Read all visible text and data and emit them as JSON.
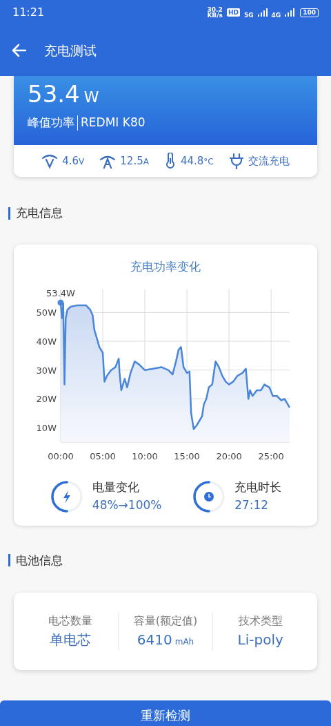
{
  "status_bar": {
    "time": "11:21",
    "speed": "30.2",
    "speed_unit": "KB/s",
    "hd": "HD",
    "net1": "5G",
    "net2": "4G",
    "battery": "100"
  },
  "header": {
    "title": "充电测试"
  },
  "power_card": {
    "value": "53.4",
    "unit": "W",
    "label": "峰值功率",
    "device": "REDMI K80",
    "stats": [
      {
        "kind": "voltage",
        "value": "4.6",
        "unit": "V"
      },
      {
        "kind": "current",
        "value": "12.5",
        "unit": "A"
      },
      {
        "kind": "temperature",
        "value": "44.8",
        "unit": "°C"
      },
      {
        "kind": "plug",
        "value": "交流充电"
      }
    ]
  },
  "charging_section": {
    "title": "充电信息",
    "chart_data": {
      "type": "area",
      "grid": true,
      "title": "充电功率变化",
      "xlim": [
        0,
        27.2
      ],
      "ylim": [
        5,
        58
      ],
      "xticks": [
        {
          "value": 0,
          "label": "00:00"
        },
        {
          "value": 5,
          "label": "05:00"
        },
        {
          "value": 10,
          "label": "10:00"
        },
        {
          "value": 15,
          "label": "15:00"
        },
        {
          "value": 20,
          "label": "20:00"
        },
        {
          "value": 25,
          "label": "25:00"
        }
      ],
      "yticks": [
        {
          "value": 10,
          "label": "10W"
        },
        {
          "value": 20,
          "label": "20W"
        },
        {
          "value": 30,
          "label": "30W"
        },
        {
          "value": 40,
          "label": "40W"
        },
        {
          "value": 50,
          "label": "50W"
        }
      ],
      "x": [
        0,
        0.15,
        0.3,
        0.45,
        0.6,
        0.8,
        1.2,
        2,
        3,
        3.5,
        3.8,
        4,
        4.3,
        4.6,
        5,
        5.2,
        5.5,
        6,
        6.5,
        6.9,
        7,
        7.2,
        7.6,
        7.9,
        8.3,
        8.8,
        9.3,
        10,
        11,
        12,
        12.8,
        13.3,
        13.7,
        14,
        14.3,
        14.6,
        15,
        15.3,
        15.5,
        15.8,
        16.2,
        16.8,
        17,
        17.3,
        17.6,
        18,
        18.4,
        18.8,
        19.2,
        19.6,
        20,
        20.5,
        21,
        21.6,
        22,
        22.3,
        22.5,
        22.8,
        23.3,
        23.8,
        24.2,
        24.8,
        25.2,
        25.7,
        26.2,
        26.6,
        27,
        27.2
      ],
      "series": [
        {
          "color": "#4a86d8",
          "values": [
            53.4,
            48,
            53,
            25,
            48,
            51,
            52,
            52.5,
            52.5,
            51,
            49,
            44,
            41,
            38,
            36,
            26,
            28,
            30,
            31,
            34,
            29,
            23,
            27,
            24,
            29,
            33,
            32,
            30,
            30.5,
            31,
            30,
            28.5,
            33,
            37,
            38,
            31,
            29,
            29.5,
            15,
            9.5,
            11,
            14,
            18,
            20,
            24,
            25,
            33,
            31,
            28,
            26,
            25,
            26,
            28,
            29,
            30.5,
            20,
            23,
            21,
            23,
            23,
            25,
            24,
            21,
            21,
            19.5,
            20,
            18,
            17
          ]
        }
      ],
      "annotations": [
        {
          "x": 0,
          "y": 53.4,
          "text": "53.4W"
        }
      ]
    },
    "summary": [
      {
        "kind": "battery",
        "label": "电量变化",
        "value": "48%→100%"
      },
      {
        "kind": "duration",
        "label": "充电时长",
        "value": "27:12"
      }
    ]
  },
  "battery_section": {
    "title": "电池信息",
    "items": [
      {
        "label": "电芯数量",
        "value": "单电芯"
      },
      {
        "label": "容量(额定值)",
        "value": "6410",
        "unit": "mAh"
      },
      {
        "label": "技术类型",
        "value": "Li-poly"
      }
    ]
  },
  "button": {
    "label": "重新检测"
  }
}
